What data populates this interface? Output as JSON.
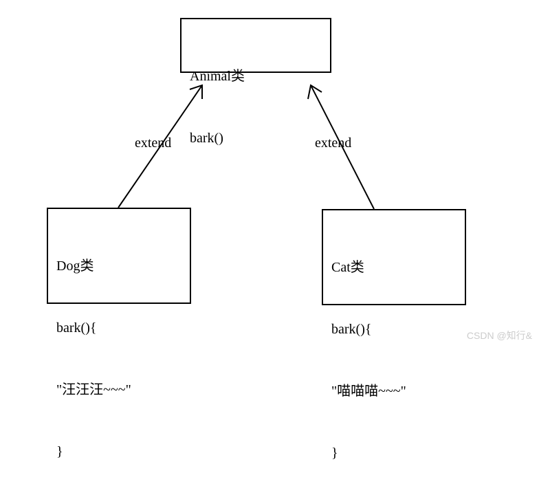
{
  "parent": {
    "line1": "Animal类",
    "line2": "bark()"
  },
  "leftChild": {
    "line1": "Dog类",
    "line2": "bark(){",
    "line3": "\"汪汪汪~~~\"",
    "line4": "}"
  },
  "rightChild": {
    "line1": "Cat类",
    "line2": "bark(){",
    "line3": "\"喵喵喵~~~\"",
    "line4": "}"
  },
  "labels": {
    "extendLeft": "extend",
    "extendRight": "extend"
  },
  "watermark": "CSDN @知行&"
}
